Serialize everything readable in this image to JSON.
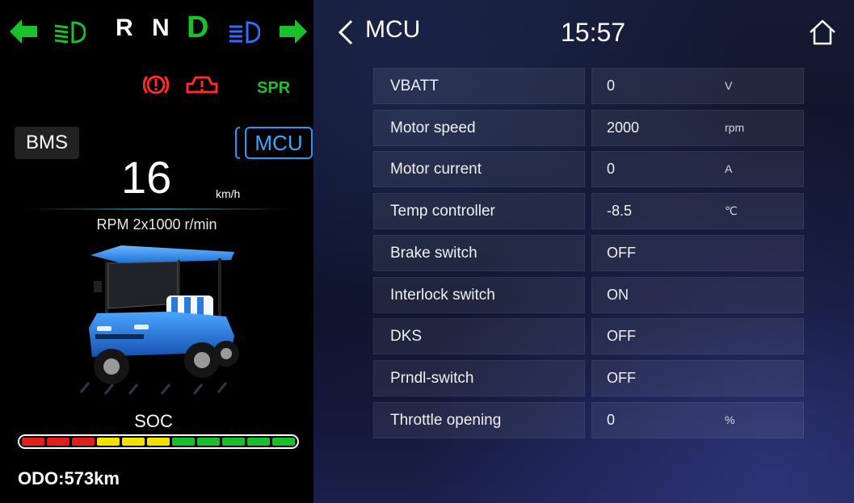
{
  "gears": {
    "r": "R",
    "n": "N",
    "d": "D"
  },
  "indicators": {
    "turn_color": "#19c22a",
    "lowbeam_color": "#19c22a",
    "highbeam_color": "#2f6cff",
    "brake_color": "#ff2a2a",
    "fault_color": "#ff2a2a",
    "spr_label": "SPR",
    "spr_color": "#1fc12a"
  },
  "mode": {
    "bms_label": "BMS",
    "mcu_label": "MCU"
  },
  "speed": {
    "value": "16",
    "unit": "km/h"
  },
  "rpm_text": "RPM 2x1000 r/min",
  "soc": {
    "label": "SOC",
    "segments": [
      "#e11d1d",
      "#e11d1d",
      "#e11d1d",
      "#f2e200",
      "#f2e200",
      "#f2e200",
      "#16c02b",
      "#16c02b",
      "#16c02b",
      "#16c02b",
      "#16c02b"
    ]
  },
  "odo": "ODO:573km",
  "header": {
    "title": "MCU",
    "clock": "15:57"
  },
  "table": {
    "rows": [
      {
        "label": "VBATT",
        "value": "0",
        "unit": "V"
      },
      {
        "label": "Motor speed",
        "value": "2000",
        "unit": "rpm"
      },
      {
        "label": "Motor current",
        "value": "0",
        "unit": "A"
      },
      {
        "label": "Temp controller",
        "value": "-8.5",
        "unit": "℃"
      },
      {
        "label": "Brake switch",
        "value": "OFF",
        "unit": ""
      },
      {
        "label": "Interlock switch",
        "value": "ON",
        "unit": ""
      },
      {
        "label": "DKS",
        "value": "OFF",
        "unit": ""
      },
      {
        "label": "Prndl-switch",
        "value": "OFF",
        "unit": ""
      },
      {
        "label": "Throttle opening",
        "value": "0",
        "unit": "%"
      }
    ]
  }
}
